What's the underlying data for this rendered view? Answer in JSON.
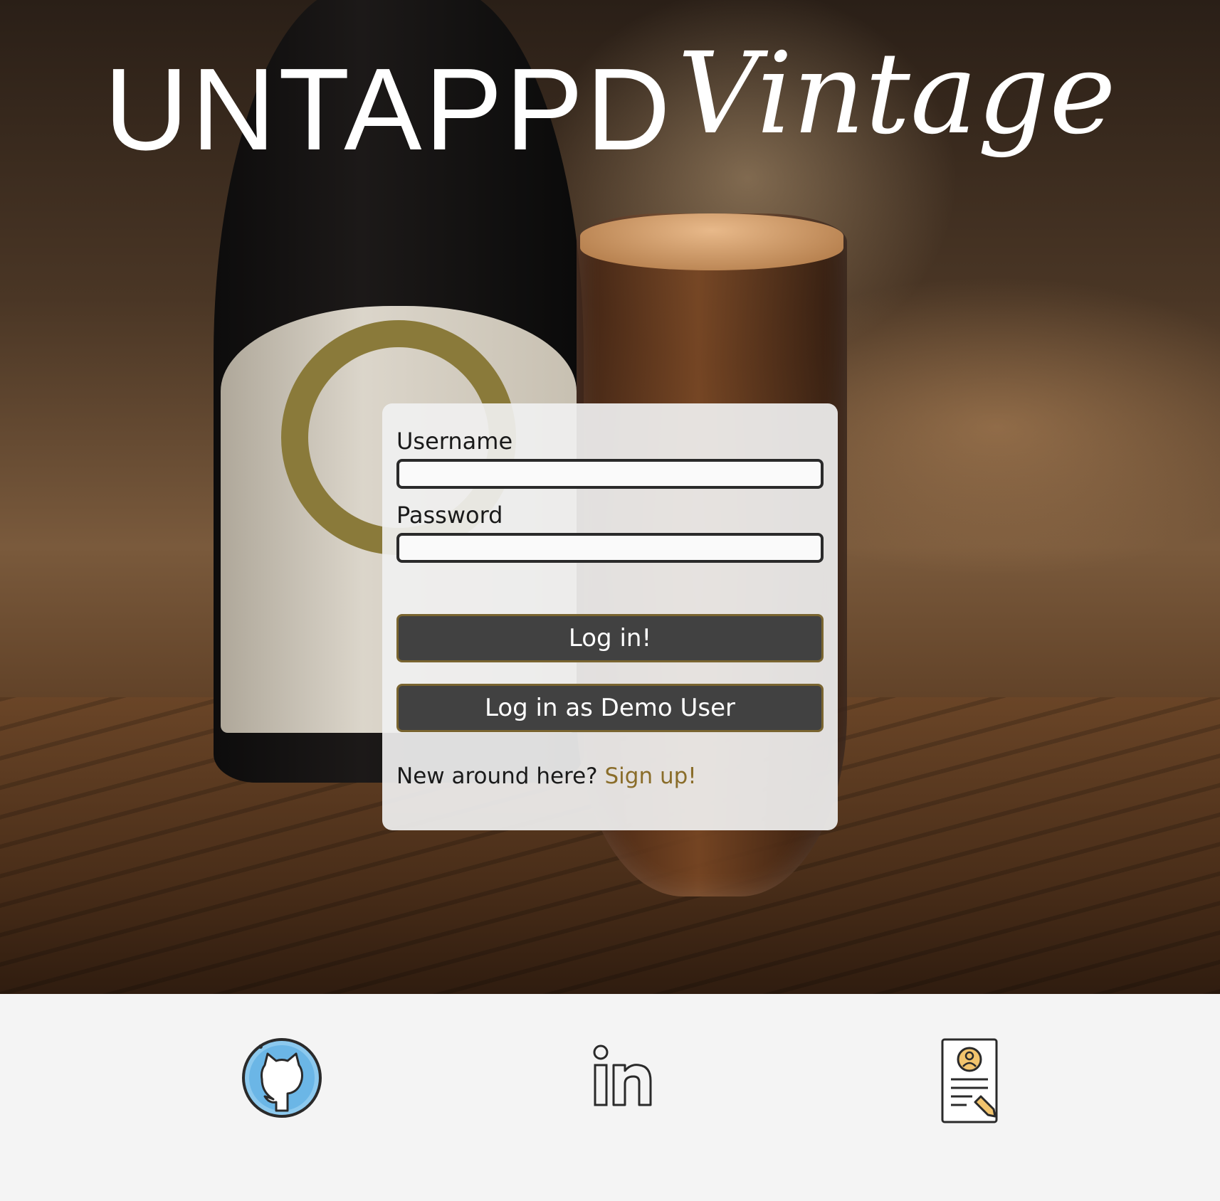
{
  "brand": {
    "main": "UNTAPPD",
    "script": "Vintage"
  },
  "login_form": {
    "username_label": "Username",
    "username_value": "",
    "password_label": "Password",
    "password_value": "",
    "login_button": "Log in!",
    "demo_button": "Log in as Demo User",
    "signup_prompt": "New around here?",
    "signup_link": "Sign up!"
  },
  "colors": {
    "button_bg": "#414141",
    "button_border": "#7a6530",
    "signup_link": "#8a6d2a",
    "footer_bg": "#f4f4f4"
  },
  "footer": {
    "icons": [
      "github-icon",
      "linkedin-icon",
      "resume-icon"
    ]
  }
}
